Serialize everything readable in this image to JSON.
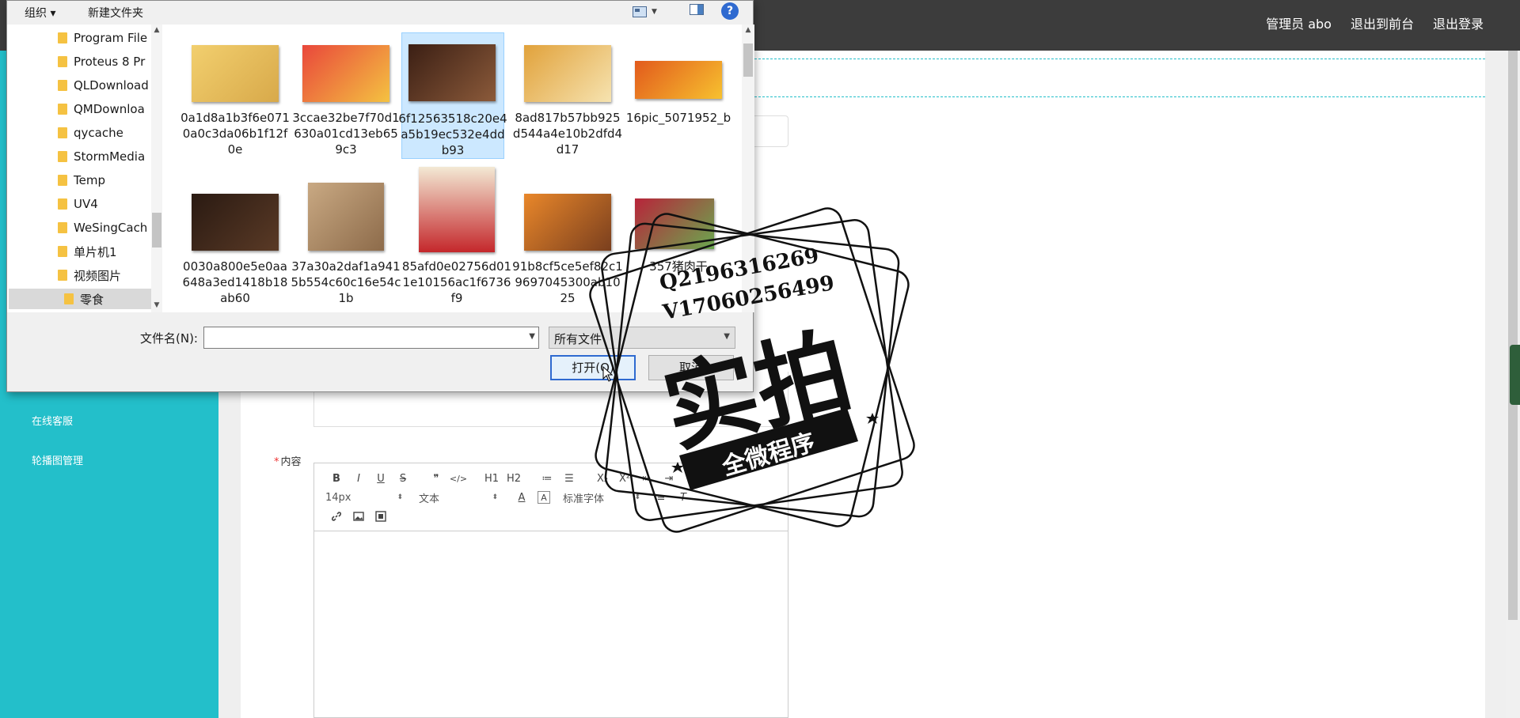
{
  "topbar": {
    "admin": "管理员 abo",
    "to_frontend": "退出到前台",
    "logout": "退出登录"
  },
  "sidebar": {
    "items": [
      "在线客服",
      "轮播图管理"
    ]
  },
  "form": {
    "content_required": "*",
    "content_label": "内容"
  },
  "editor": {
    "toolbar": {
      "row1": [
        "B",
        "I",
        "U",
        "S",
        "❞",
        "</>",
        "H1",
        "H2",
        "≔",
        "☰",
        "X₂",
        "X²",
        "⇤",
        "⇥"
      ],
      "font_size": "14px",
      "paragraph": "文本",
      "font_family": "标准字体",
      "row3_icons": [
        "link-icon",
        "image-icon",
        "video-icon"
      ]
    }
  },
  "dialog": {
    "toolbar": {
      "organize": "组织 ▾",
      "new_folder": "新建文件夹",
      "help": "?"
    },
    "nav_items": [
      "Program File",
      "Proteus 8 Pr",
      "QLDownload",
      "QMDownloa",
      "qycache",
      "StormMedia",
      "Temp",
      "UV4",
      "WeSingCach",
      "单片机1",
      "视频图片",
      "零食"
    ],
    "selected_nav": "零食",
    "files": [
      {
        "name": "0a1d8a1b3f6e0710a0c3da06b1f12f0e",
        "colors": [
          "#f2cf6e",
          "#d8a94a"
        ]
      },
      {
        "name": "3ccae32be7f70d1630a01cd13eb659c3",
        "colors": [
          "#e9473b",
          "#f4c241"
        ]
      },
      {
        "name": "6f12563518c20e4a5b19ec532e4ddb93",
        "colors": [
          "#3b1f14",
          "#8b5a3a"
        ],
        "selected": true
      },
      {
        "name": "8ad817b57bb925d544a4e10b2dfd4d17",
        "colors": [
          "#e1a23b",
          "#f6e3b0"
        ]
      },
      {
        "name": "16pic_5071952_b",
        "colors": [
          "#e25a1c",
          "#f7c12f"
        ]
      },
      {
        "name": "0030a800e5e0aa648a3ed1418b18ab60",
        "colors": [
          "#2a1a12",
          "#5a3a26"
        ]
      },
      {
        "name": "37a30a2daf1a9415b554c60c16e54c1b",
        "colors": [
          "#c9a983",
          "#8d6b4a"
        ]
      },
      {
        "name": "85afd0e02756d011e10156ac1f6736f9",
        "colors": [
          "#c4272b",
          "#f3e9d4"
        ]
      },
      {
        "name": "91b8cf5ce5ef82c19697045300ab1025",
        "colors": [
          "#e9872a",
          "#7a3f1e"
        ]
      },
      {
        "name": "357猪肉干",
        "colors": [
          "#b8243a",
          "#6aa84f"
        ]
      }
    ],
    "filename_label": "文件名(N):",
    "filename_value": "",
    "filetype": "所有文件",
    "open_button": "打开(O)",
    "cancel_button": "取消"
  },
  "watermark": {
    "line1": "Q2196316269",
    "line2": "V17060256499",
    "big": "实拍",
    "banner": "全微程序"
  },
  "colors": {
    "teal": "#23bfca",
    "topbar": "#3c3c3c",
    "selection": "#cce8ff",
    "accent_blue": "#2f6ad0"
  }
}
